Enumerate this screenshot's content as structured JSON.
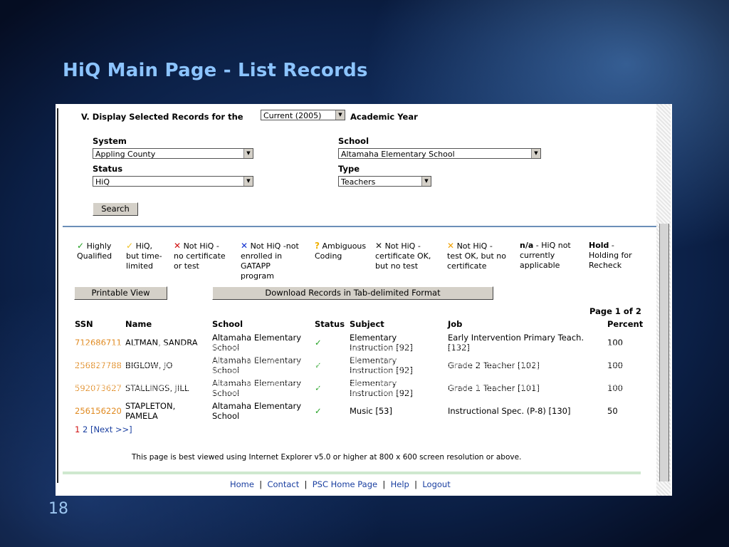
{
  "slide": {
    "title": "HiQ Main Page - List Records",
    "number": "18"
  },
  "form": {
    "heading_prefix": "V. Display Selected Records for the",
    "heading_suffix": "Academic Year",
    "year_select": "Current (2005)",
    "system_label": "System",
    "system_value": "Appling County",
    "school_label": "School",
    "school_value": "Altamaha Elementary School",
    "status_label": "Status",
    "status_value": "HiQ",
    "type_label": "Type",
    "type_value": "Teachers",
    "search_button": "Search"
  },
  "legend": {
    "highly_qualified": "Highly\nQualified",
    "hiq_time_limited": "HiQ,\nbut time-\nlimited",
    "not_hiq_no_cert": "Not HiQ -\nno certificate\nor test",
    "not_hiq_not_enrolled": "Not HiQ -not\nenrolled in\nGATAPP\nprogram",
    "ambiguous": "Ambiguous\nCoding",
    "cert_ok_no_test": "Not HiQ -\ncertificate OK,\nbut no test",
    "test_ok_no_cert": "Not HiQ -\ntest OK, but no\ncertificate",
    "na_label": "n/a",
    "na_text": " - HiQ not\ncurrently\napplicable",
    "hold_label": "Hold",
    "hold_text": " -\nHolding for\nRecheck"
  },
  "actions": {
    "printable_view": "Printable View",
    "download": "Download Records in Tab-delimited Format"
  },
  "table": {
    "page_info": "Page 1 of 2",
    "headers": [
      "SSN",
      "Name",
      "School",
      "Status",
      "Subject",
      "Job",
      "Percent"
    ],
    "rows": [
      {
        "ssn": "712686711",
        "name": "ALTMAN, SANDRA",
        "school": "Altamaha Elementary\nSchool",
        "status": "✓",
        "subject": "Elementary\nInstruction [92]",
        "job": "Early Intervention Primary Teach.\n[132]",
        "percent": "100"
      },
      {
        "ssn": "256827788",
        "name": "BIGLOW, JO",
        "school": "Altamaha Elementary\nSchool",
        "status": "✓",
        "subject": "Elementary\nInstruction [92]",
        "job": "Grade 2 Teacher [102]",
        "percent": "100"
      },
      {
        "ssn": "592073627",
        "name": "STALLINGS, JILL",
        "school": "Altamaha Elementary\nSchool",
        "status": "✓",
        "subject": "Elementary\nInstruction [92]",
        "job": "Grade 1 Teacher [101]",
        "percent": "100"
      },
      {
        "ssn": "256156220",
        "name": "STAPLETON,\nPAMELA",
        "school": "Altamaha Elementary\nSchool",
        "status": "✓",
        "subject": "Music [53]",
        "job": "Instructional Spec. (P-8) [130]",
        "percent": "50"
      }
    ]
  },
  "pagination": {
    "current": "1",
    "next_page": "2",
    "next_link": "[Next >>]"
  },
  "footer": {
    "note": "This page is best viewed using Internet Explorer v5.0 or higher at 800 x 600 screen resolution or above.",
    "links": [
      "Home",
      "Contact",
      "PSC Home Page",
      "Help",
      "Logout"
    ]
  },
  "colors": {
    "title": "#8cc4ff",
    "ssn": "#e08a20",
    "check": "#20a020",
    "link": "#1a3fa0"
  }
}
